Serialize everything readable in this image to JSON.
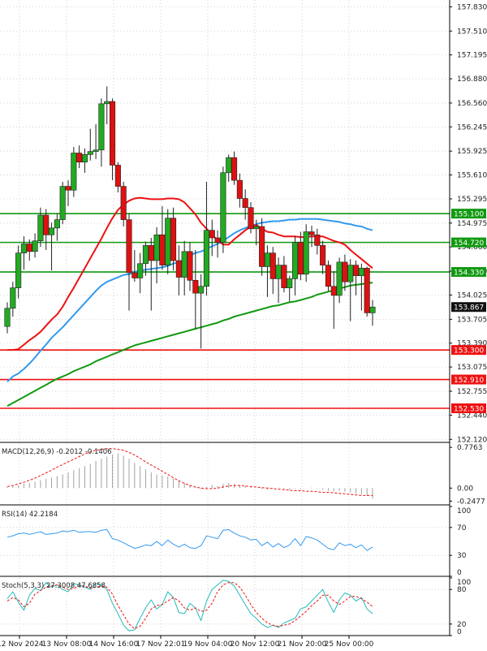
{
  "chart_data": [
    {
      "type": "candlestick",
      "y_axis_ticks": [
        "157.830",
        "157.510",
        "157.195",
        "156.880",
        "156.560",
        "156.245",
        "155.925",
        "155.610",
        "155.295",
        "154.975",
        "154.660",
        "154.340",
        "154.025",
        "153.705",
        "153.390",
        "153.075",
        "152.755",
        "152.440",
        "152.120"
      ],
      "x_axis_ticks": [
        "12 Nov 2024",
        "13 Nov 08:00",
        "14 Nov 16:00",
        "17 Nov 22:01",
        "19 Nov 04:00",
        "20 Nov 12:00",
        "21 Nov 20:00",
        "25 Nov 00:00"
      ],
      "ylim": [
        152.08,
        157.92
      ],
      "current_price": "153.867",
      "resistance_levels": [
        "155.100",
        "154.720",
        "154.330"
      ],
      "support_levels": [
        "153.300",
        "152.910",
        "152.530"
      ],
      "colors": {
        "bull": "#22aa22",
        "bear": "#dd1111",
        "resistance": "#119911",
        "support": "#ee1111",
        "ma_fast": "#ee1111",
        "ma_mid": "#3399ee",
        "ma_slow": "#119911"
      },
      "candles": [
        [
          153.61,
          153.93,
          153.52,
          153.85
        ],
        [
          153.85,
          154.2,
          153.74,
          154.12
        ],
        [
          154.12,
          154.68,
          153.98,
          154.58
        ],
        [
          154.58,
          154.8,
          154.36,
          154.7
        ],
        [
          154.7,
          154.76,
          154.48,
          154.6
        ],
        [
          154.6,
          154.84,
          154.52,
          154.74
        ],
        [
          154.74,
          155.18,
          154.66,
          155.08
        ],
        [
          155.08,
          155.16,
          154.62,
          154.82
        ],
        [
          154.82,
          154.98,
          154.35,
          154.91
        ],
        [
          154.91,
          155.1,
          154.74,
          155.02
        ],
        [
          155.02,
          155.52,
          154.96,
          155.46
        ],
        [
          155.46,
          155.54,
          155.2,
          155.41
        ],
        [
          155.41,
          155.98,
          155.32,
          155.9
        ],
        [
          155.9,
          156.0,
          155.7,
          155.78
        ],
        [
          155.78,
          155.96,
          155.64,
          155.88
        ],
        [
          155.88,
          156.22,
          155.8,
          155.92
        ],
        [
          155.92,
          156.28,
          155.82,
          155.94
        ],
        [
          155.94,
          156.62,
          155.72,
          156.55
        ],
        [
          156.55,
          156.78,
          156.28,
          156.58
        ],
        [
          156.58,
          156.62,
          155.54,
          155.74
        ],
        [
          155.74,
          155.78,
          155.38,
          155.46
        ],
        [
          155.46,
          155.52,
          154.93,
          155.02
        ],
        [
          155.02,
          155.1,
          153.82,
          154.32
        ],
        [
          154.32,
          154.62,
          154.2,
          154.25
        ],
        [
          154.25,
          154.58,
          154.05,
          154.44
        ],
        [
          154.44,
          154.73,
          154.28,
          154.68
        ],
        [
          154.68,
          154.78,
          153.82,
          154.48
        ],
        [
          154.48,
          154.92,
          154.18,
          154.82
        ],
        [
          154.82,
          155.2,
          154.36,
          154.42
        ],
        [
          154.42,
          155.16,
          154.3,
          155.04
        ],
        [
          155.04,
          155.18,
          154.35,
          154.48
        ],
        [
          154.48,
          154.68,
          154.02,
          154.26
        ],
        [
          154.26,
          154.74,
          154.02,
          154.6
        ],
        [
          154.6,
          154.72,
          154.08,
          154.22
        ],
        [
          154.22,
          154.62,
          153.58,
          154.05
        ],
        [
          154.05,
          154.3,
          153.32,
          154.14
        ],
        [
          154.14,
          155.52,
          154.02,
          154.88
        ],
        [
          154.88,
          155.02,
          154.54,
          154.78
        ],
        [
          154.78,
          154.88,
          154.52,
          154.72
        ],
        [
          154.72,
          155.72,
          154.58,
          155.64
        ],
        [
          155.64,
          155.88,
          155.52,
          155.84
        ],
        [
          155.84,
          155.92,
          155.48,
          155.54
        ],
        [
          155.54,
          155.63,
          155.18,
          155.3
        ],
        [
          155.3,
          155.42,
          155.02,
          155.18
        ],
        [
          155.18,
          155.25,
          154.84,
          154.9
        ],
        [
          154.9,
          155.02,
          154.68,
          154.93
        ],
        [
          154.93,
          155.04,
          154.28,
          154.4
        ],
        [
          154.4,
          154.68,
          154.0,
          154.58
        ],
        [
          154.58,
          154.66,
          154.04,
          154.24
        ],
        [
          154.24,
          154.52,
          153.92,
          154.42
        ],
        [
          154.42,
          154.54,
          154.06,
          154.12
        ],
        [
          154.12,
          154.28,
          153.94,
          154.24
        ],
        [
          154.24,
          154.8,
          154.02,
          154.72
        ],
        [
          154.72,
          154.86,
          154.22,
          154.3
        ],
        [
          154.3,
          154.96,
          154.2,
          154.86
        ],
        [
          154.86,
          154.94,
          154.66,
          154.82
        ],
        [
          154.82,
          154.9,
          154.56,
          154.68
        ],
        [
          154.68,
          154.74,
          154.3,
          154.42
        ],
        [
          154.42,
          154.48,
          154.08,
          154.14
        ],
        [
          154.14,
          154.34,
          153.58,
          154.02
        ],
        [
          154.02,
          154.52,
          153.92,
          154.46
        ],
        [
          154.46,
          154.56,
          154.08,
          154.2
        ],
        [
          154.2,
          154.5,
          153.68,
          154.42
        ],
        [
          154.42,
          154.48,
          154.02,
          154.28
        ],
        [
          154.28,
          154.44,
          153.82,
          154.38
        ],
        [
          154.38,
          154.4,
          153.74,
          153.79
        ],
        [
          153.79,
          153.96,
          153.62,
          153.867
        ]
      ],
      "ma_fast": [
        153.3,
        153.3,
        153.31,
        153.37,
        153.43,
        153.48,
        153.54,
        153.62,
        153.7,
        153.77,
        153.87,
        154.0,
        154.12,
        154.25,
        154.38,
        154.51,
        154.64,
        154.77,
        154.91,
        155.04,
        155.15,
        155.22,
        155.27,
        155.3,
        155.31,
        155.3,
        155.29,
        155.29,
        155.29,
        155.3,
        155.3,
        155.29,
        155.25,
        155.17,
        155.09,
        154.98,
        154.9,
        154.82,
        154.75,
        154.69,
        154.69,
        154.76,
        154.82,
        154.88,
        154.93,
        154.95,
        154.9,
        154.86,
        154.85,
        154.82,
        154.8,
        154.8,
        154.8,
        154.79,
        154.79,
        154.8,
        154.8,
        154.8,
        154.77,
        154.74,
        154.72,
        154.69,
        154.62,
        154.56,
        154.5,
        154.44,
        154.38
      ],
      "ma_mid": [
        152.88,
        152.95,
        152.99,
        153.05,
        153.12,
        153.2,
        153.29,
        153.37,
        153.46,
        153.53,
        153.6,
        153.68,
        153.76,
        153.84,
        153.92,
        154.0,
        154.08,
        154.15,
        154.2,
        154.23,
        154.26,
        154.29,
        154.3,
        154.33,
        154.35,
        154.36,
        154.37,
        154.38,
        154.39,
        154.41,
        154.44,
        154.46,
        154.5,
        154.55,
        154.58,
        154.6,
        154.63,
        154.67,
        154.7,
        154.74,
        154.79,
        154.84,
        154.88,
        154.91,
        154.94,
        154.96,
        154.98,
        154.99,
        155.0,
        155.0,
        155.01,
        155.02,
        155.02,
        155.03,
        155.03,
        155.03,
        155.03,
        155.02,
        155.01,
        155.0,
        154.99,
        154.97,
        154.96,
        154.94,
        154.93,
        154.9,
        154.88
      ],
      "ma_slow": [
        152.56,
        152.6,
        152.64,
        152.68,
        152.72,
        152.76,
        152.8,
        152.84,
        152.88,
        152.92,
        152.95,
        152.98,
        153.02,
        153.05,
        153.08,
        153.11,
        153.15,
        153.18,
        153.21,
        153.24,
        153.27,
        153.3,
        153.33,
        153.36,
        153.38,
        153.4,
        153.42,
        153.44,
        153.46,
        153.48,
        153.5,
        153.52,
        153.54,
        153.56,
        153.58,
        153.6,
        153.62,
        153.64,
        153.66,
        153.69,
        153.71,
        153.74,
        153.76,
        153.78,
        153.8,
        153.82,
        153.84,
        153.86,
        153.88,
        153.89,
        153.91,
        153.93,
        153.94,
        153.96,
        153.98,
        154.0,
        154.03,
        154.05,
        154.07,
        154.09,
        154.11,
        154.13,
        154.15,
        154.16,
        154.17,
        154.18,
        154.19
      ]
    },
    {
      "type": "bar",
      "label": "MACD(12,26,9) -0.2012 -0.1406",
      "y_axis_ticks": [
        "0.7763",
        "0.00",
        "-0.2477"
      ],
      "ylim": [
        -0.32,
        0.84
      ],
      "colors": {
        "hist": "#a0a0a0",
        "signal": "#ee1111"
      },
      "histogram": [
        0.02,
        0.03,
        0.05,
        0.08,
        0.1,
        0.12,
        0.15,
        0.18,
        0.2,
        0.23,
        0.26,
        0.3,
        0.34,
        0.38,
        0.42,
        0.46,
        0.52,
        0.56,
        0.6,
        0.64,
        0.66,
        0.62,
        0.56,
        0.48,
        0.42,
        0.36,
        0.3,
        0.26,
        0.24,
        0.22,
        0.18,
        0.14,
        0.1,
        0.06,
        0.02,
        -0.02,
        0.02,
        0.06,
        0.04,
        0.08,
        0.1,
        0.08,
        0.06,
        0.04,
        0.02,
        0.0,
        -0.02,
        -0.03,
        -0.01,
        0.01,
        -0.02,
        -0.03,
        -0.01,
        -0.02,
        0.0,
        0.01,
        -0.01,
        -0.03,
        -0.05,
        -0.06,
        -0.05,
        -0.07,
        -0.08,
        -0.1,
        -0.12,
        -0.15,
        -0.2
      ],
      "signal": [
        0.03,
        0.05,
        0.08,
        0.11,
        0.15,
        0.19,
        0.24,
        0.29,
        0.34,
        0.4,
        0.45,
        0.5,
        0.55,
        0.6,
        0.65,
        0.69,
        0.72,
        0.74,
        0.75,
        0.75,
        0.74,
        0.72,
        0.68,
        0.63,
        0.57,
        0.5,
        0.44,
        0.38,
        0.32,
        0.26,
        0.2,
        0.14,
        0.09,
        0.05,
        0.02,
        0.0,
        -0.01,
        -0.01,
        0.0,
        0.02,
        0.04,
        0.05,
        0.05,
        0.04,
        0.03,
        0.02,
        0.01,
        0.0,
        -0.01,
        -0.02,
        -0.03,
        -0.04,
        -0.05,
        -0.05,
        -0.06,
        -0.06,
        -0.07,
        -0.08,
        -0.08,
        -0.09,
        -0.1,
        -0.11,
        -0.12,
        -0.13,
        -0.14,
        -0.14,
        -0.14
      ]
    },
    {
      "type": "line",
      "label": "RSI(14) 42.2184",
      "y_axis_ticks": [
        "100",
        "70",
        "30",
        "0"
      ],
      "ylim": [
        0,
        100
      ],
      "colors": {
        "line": "#3399ee"
      },
      "values": [
        56,
        58,
        61,
        62,
        60,
        62,
        64,
        60,
        61,
        62,
        65,
        64,
        66,
        63,
        64,
        64,
        63,
        66,
        67,
        54,
        52,
        48,
        44,
        40,
        42,
        45,
        44,
        50,
        44,
        52,
        46,
        42,
        46,
        41,
        40,
        44,
        58,
        56,
        54,
        66,
        67,
        62,
        58,
        56,
        52,
        53,
        44,
        49,
        42,
        47,
        41,
        45,
        54,
        44,
        57,
        55,
        52,
        46,
        40,
        38,
        48,
        44,
        46,
        41,
        45,
        37,
        42
      ]
    },
    {
      "type": "line",
      "label": "Stoch(5,3,3) 27.3008 47.6858",
      "y_axis_ticks": [
        "100",
        "80",
        "20",
        "0"
      ],
      "ylim": [
        0,
        100
      ],
      "colors": {
        "k": "#22bbbb",
        "d": "#ee1111"
      },
      "k": [
        64,
        76,
        58,
        44,
        70,
        82,
        78,
        92,
        84,
        88,
        80,
        76,
        90,
        88,
        84,
        80,
        90,
        88,
        80,
        56,
        38,
        18,
        8,
        10,
        30,
        48,
        62,
        46,
        54,
        76,
        66,
        40,
        38,
        56,
        48,
        26,
        60,
        80,
        88,
        96,
        94,
        86,
        70,
        54,
        38,
        30,
        20,
        14,
        18,
        14,
        22,
        26,
        30,
        46,
        50,
        60,
        70,
        80,
        58,
        40,
        62,
        74,
        70,
        60,
        66,
        46,
        38
      ],
      "d": [
        60,
        66,
        62,
        50,
        56,
        72,
        78,
        84,
        86,
        88,
        84,
        80,
        82,
        86,
        86,
        82,
        84,
        86,
        84,
        72,
        52,
        36,
        20,
        12,
        16,
        30,
        46,
        52,
        54,
        60,
        66,
        60,
        48,
        44,
        48,
        42,
        44,
        56,
        76,
        88,
        92,
        92,
        84,
        70,
        54,
        40,
        30,
        22,
        18,
        16,
        18,
        20,
        26,
        34,
        42,
        52,
        60,
        70,
        70,
        60,
        54,
        60,
        68,
        68,
        64,
        58,
        50
      ]
    }
  ]
}
